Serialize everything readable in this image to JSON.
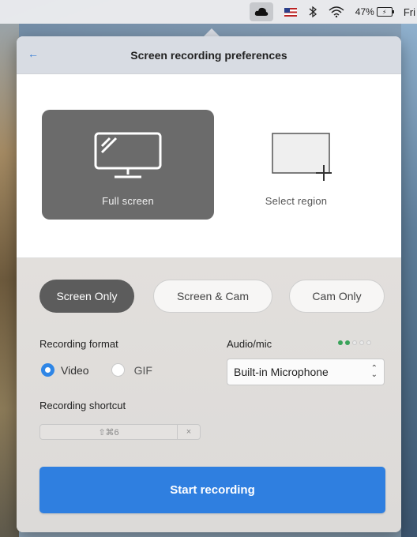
{
  "menubar": {
    "battery_percent": "47%",
    "clock": "Fri"
  },
  "header": {
    "back_label": "←",
    "title": "Screen recording preferences"
  },
  "modes": {
    "full_screen_label": "Full screen",
    "select_region_label": "Select region"
  },
  "capture_tabs": [
    {
      "label": "Screen Only",
      "selected": true
    },
    {
      "label": "Screen & Cam",
      "selected": false
    },
    {
      "label": "Cam Only",
      "selected": false
    }
  ],
  "format": {
    "label": "Recording format",
    "options": [
      {
        "label": "Video",
        "selected": true
      },
      {
        "label": "GIF",
        "selected": false
      }
    ]
  },
  "audio": {
    "label": "Audio/mic",
    "level": 0.4,
    "selected_device": "Built-in Microphone"
  },
  "shortcut": {
    "label": "Recording shortcut",
    "value": "⇧⌘6",
    "clear_label": "×"
  },
  "start_button_label": "Start recording",
  "colors": {
    "accent": "#2f7fe0",
    "active_tab": "#5c5c5c",
    "level_on": "#3aa35a"
  }
}
